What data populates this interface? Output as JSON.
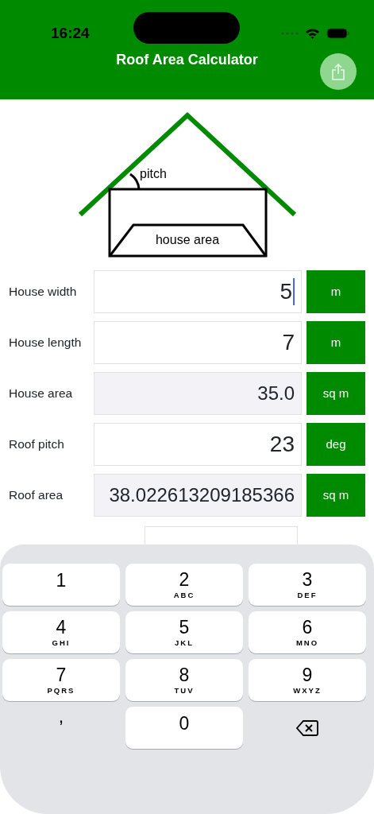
{
  "status_bar": {
    "time": "16:24"
  },
  "nav_bar": {
    "title": "Roof Area Calculator"
  },
  "diagram": {
    "pitch_label": "pitch",
    "area_label": "house area"
  },
  "rows": [
    {
      "label": "House width",
      "value": "5",
      "unit": "m",
      "readonly": false,
      "focused": true
    },
    {
      "label": "House length",
      "value": "7",
      "unit": "m",
      "readonly": false,
      "focused": false
    },
    {
      "label": "House area",
      "value": "35.0",
      "unit": "sq m",
      "readonly": true,
      "focused": false
    },
    {
      "label": "Roof pitch",
      "value": "23",
      "unit": "deg",
      "readonly": false,
      "focused": false
    },
    {
      "label": "Roof area",
      "value": "38.022613209185366",
      "unit": "sq m",
      "readonly": true,
      "focused": false
    }
  ],
  "keyboard": {
    "keys": [
      {
        "kind": "digit",
        "digit": "1"
      },
      {
        "kind": "digit",
        "digit": "2",
        "letters": "ABC"
      },
      {
        "kind": "digit",
        "digit": "3",
        "letters": "DEF"
      },
      {
        "kind": "digit",
        "digit": "4",
        "letters": "GHI"
      },
      {
        "kind": "digit",
        "digit": "5",
        "letters": "JKL"
      },
      {
        "kind": "digit",
        "digit": "6",
        "letters": "MNO"
      },
      {
        "kind": "digit",
        "digit": "7",
        "letters": "PQRS"
      },
      {
        "kind": "digit",
        "digit": "8",
        "letters": "TUV"
      },
      {
        "kind": "digit",
        "digit": "9",
        "letters": "WXYZ"
      },
      {
        "kind": "plain",
        "digit": ","
      },
      {
        "kind": "digit",
        "digit": "0"
      },
      {
        "kind": "delete"
      }
    ]
  }
}
